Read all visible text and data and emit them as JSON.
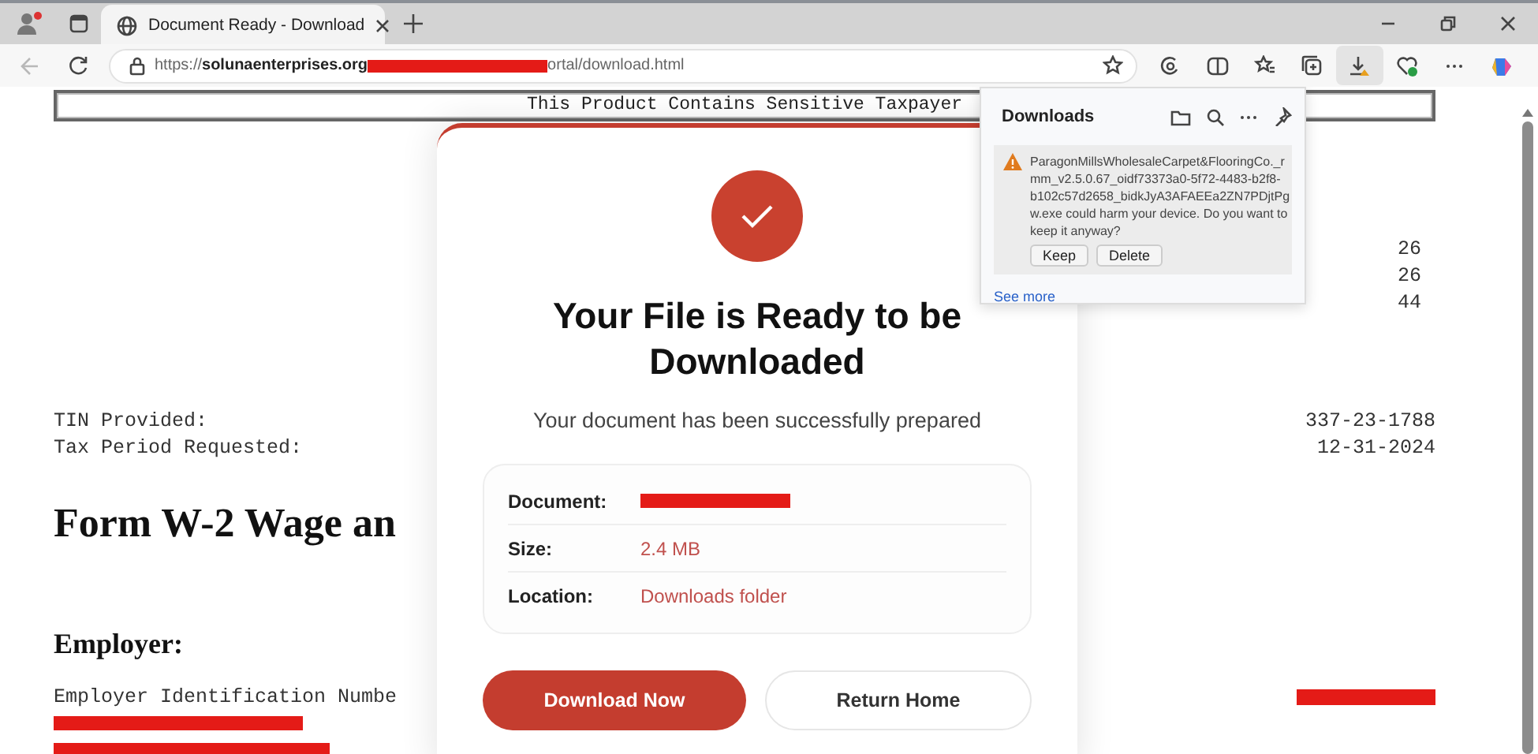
{
  "browser": {
    "tab": {
      "title": "Document Ready - Download",
      "selected": true
    },
    "back_disabled": true,
    "url_start": "https://**solunaenterprises.org**",
    "url_end": "ortal/download.html",
    "downloads_active": true
  },
  "document": {
    "banner": "This Product Contains Sensitive Taxpayer",
    "right_values": [
      "26",
      "26",
      "44"
    ],
    "fields": [
      {
        "label": "TIN Provided:",
        "value": "337-23-1788"
      },
      {
        "label": "Tax Period Requested:",
        "value": "12-31-2024"
      }
    ],
    "heading": "Form W-2 Wage an",
    "section": "Employer:",
    "ein_label": "Employer Identification Numbe"
  },
  "modal": {
    "title": "Your File is Ready to be Downloaded",
    "subtitle": "Your document has been successfully prepared",
    "details": [
      {
        "label": "Document:",
        "kind": "redacted"
      },
      {
        "label": "Size:",
        "kind": "text",
        "value": "2.4 MB"
      },
      {
        "label": "Location:",
        "kind": "text",
        "value": "Downloads folder"
      }
    ],
    "buttons": [
      {
        "label": "Download Now",
        "kind": "primary"
      },
      {
        "label": "Return Home",
        "kind": "secondary"
      }
    ]
  },
  "downloads_panel": {
    "title": "Downloads",
    "warning": "ParagonMillsWholesaleCarpet&FlooringCo._rmm_v2.5.0.67_oidf73373a0-5f72-4483-b2f8-b102c57d2658_bidkJyA3AFAEEa2ZN7PDjtPgw.exe could harm your device. Do you want to keep it anyway?",
    "actions": [
      "Keep",
      "Delete"
    ],
    "link": "See more"
  }
}
